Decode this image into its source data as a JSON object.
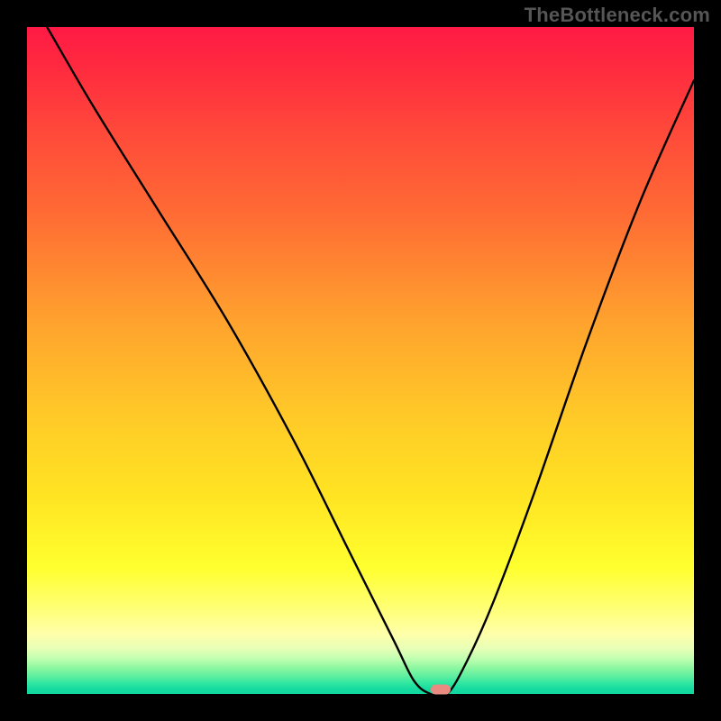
{
  "watermark": "TheBottleneck.com",
  "chart_data": {
    "type": "line",
    "title": "",
    "xlabel": "",
    "ylabel": "",
    "xlim": [
      0,
      100
    ],
    "ylim": [
      0,
      100
    ],
    "x": [
      0,
      3,
      10,
      20,
      30,
      40,
      48,
      55,
      58,
      60.5,
      63,
      66,
      70,
      76,
      84,
      92,
      100
    ],
    "values": [
      105,
      100,
      88,
      72,
      56,
      38,
      22,
      8,
      2,
      0,
      0,
      5,
      14,
      30,
      53,
      74,
      92
    ],
    "marker": {
      "x": 62,
      "y_percent_from_top": 99.3
    },
    "background_gradient_stops": [
      {
        "pct": 0,
        "color": "#ff1a45"
      },
      {
        "pct": 44,
        "color": "#ffa22e"
      },
      {
        "pct": 81,
        "color": "#ffff2e"
      },
      {
        "pct": 100,
        "color": "#11d8a0"
      }
    ]
  }
}
